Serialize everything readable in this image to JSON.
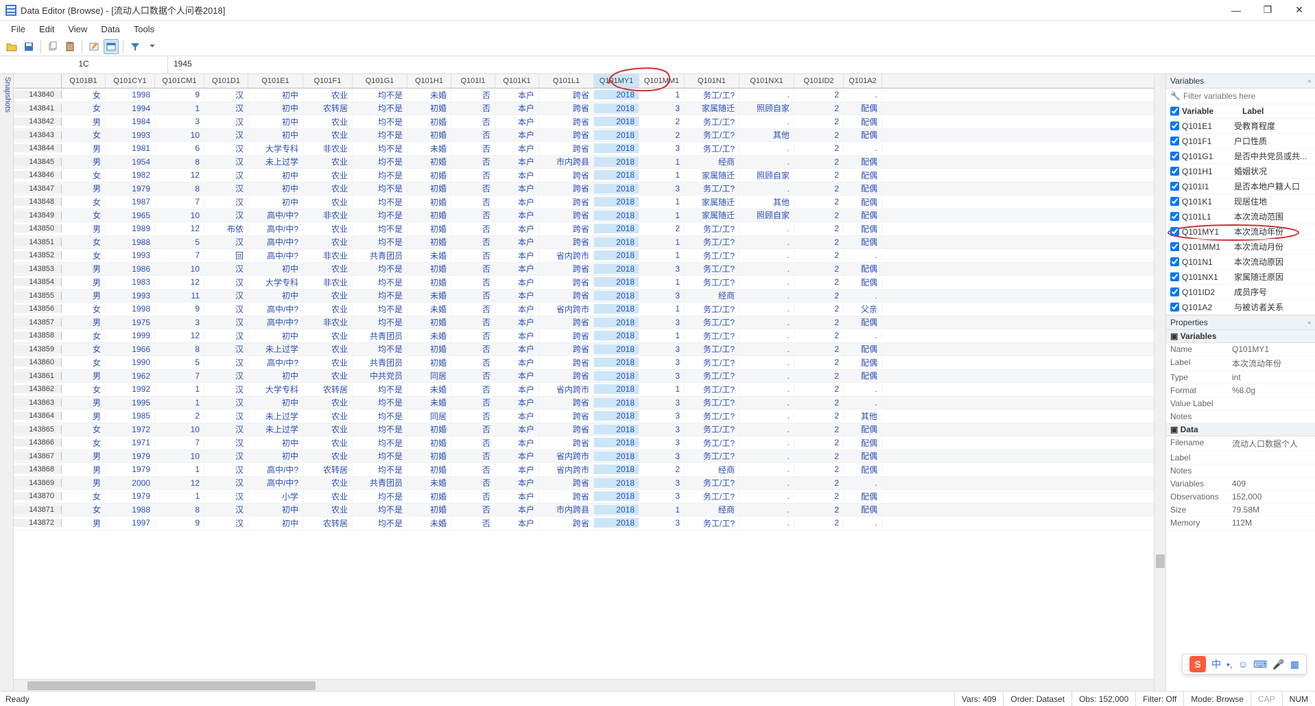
{
  "title": "Data Editor (Browse) - [流动人口数据个人问卷2018]",
  "menu": [
    "File",
    "Edit",
    "View",
    "Data",
    "Tools"
  ],
  "cellbar": {
    "ref": "1C",
    "val": "1945"
  },
  "snapshots_label": "Snapshots",
  "columns": [
    {
      "key": "Q101B1",
      "w": "w-b1"
    },
    {
      "key": "Q101CY1",
      "w": "w-cy1"
    },
    {
      "key": "Q101CM1",
      "w": "w-cm1"
    },
    {
      "key": "Q101D1",
      "w": "w-d1"
    },
    {
      "key": "Q101E1",
      "w": "w-e1"
    },
    {
      "key": "Q101F1",
      "w": "w-f1"
    },
    {
      "key": "Q101G1",
      "w": "w-g1"
    },
    {
      "key": "Q101H1",
      "w": "w-h1"
    },
    {
      "key": "Q101I1",
      "w": "w-i1"
    },
    {
      "key": "Q101K1",
      "w": "w-k1"
    },
    {
      "key": "Q101L1",
      "w": "w-l1"
    },
    {
      "key": "Q101MY1",
      "w": "w-my1",
      "hilite": true
    },
    {
      "key": "Q101MM1",
      "w": "w-mm1"
    },
    {
      "key": "Q101N1",
      "w": "w-n1"
    },
    {
      "key": "Q101NX1",
      "w": "w-nx1"
    },
    {
      "key": "Q101ID2",
      "w": "w-id2"
    },
    {
      "key": "Q101A2",
      "w": "w-a2"
    }
  ],
  "rows": [
    {
      "n": 143840,
      "c": [
        "女",
        "1998",
        "9",
        "汉",
        "初中",
        "农业",
        "均不是",
        "未婚",
        "否",
        "本户",
        "跨省",
        "2018",
        "1",
        "务工/工?",
        ".",
        "2",
        "."
      ]
    },
    {
      "n": 143841,
      "c": [
        "女",
        "1994",
        "1",
        "汉",
        "初中",
        "农转居",
        "均不是",
        "初婚",
        "否",
        "本户",
        "跨省",
        "2018",
        "3",
        "家属随迁",
        "照顾自家",
        "2",
        "配偶"
      ]
    },
    {
      "n": 143842,
      "c": [
        "男",
        "1984",
        "3",
        "汉",
        "初中",
        "农业",
        "均不是",
        "初婚",
        "否",
        "本户",
        "跨省",
        "2018",
        "2",
        "务工/工?",
        ".",
        "2",
        "配偶"
      ]
    },
    {
      "n": 143843,
      "c": [
        "女",
        "1993",
        "10",
        "汉",
        "初中",
        "农业",
        "均不是",
        "初婚",
        "否",
        "本户",
        "跨省",
        "2018",
        "2",
        "务工/工?",
        "其他",
        "2",
        "配偶"
      ]
    },
    {
      "n": 143844,
      "c": [
        "男",
        "1981",
        "6",
        "汉",
        "大学专科",
        "非农业",
        "均不是",
        "未婚",
        "否",
        "本户",
        "跨省",
        "2018",
        "3",
        "务工/工?",
        ".",
        "2",
        "."
      ]
    },
    {
      "n": 143845,
      "c": [
        "男",
        "1954",
        "8",
        "汉",
        "未上过学",
        "农业",
        "均不是",
        "初婚",
        "否",
        "本户",
        "市内跨县",
        "2018",
        "1",
        "经商",
        ".",
        "2",
        "配偶"
      ]
    },
    {
      "n": 143846,
      "c": [
        "女",
        "1982",
        "12",
        "汉",
        "初中",
        "农业",
        "均不是",
        "初婚",
        "否",
        "本户",
        "跨省",
        "2018",
        "1",
        "家属随迁",
        "照顾自家",
        "2",
        "配偶"
      ]
    },
    {
      "n": 143847,
      "c": [
        "男",
        "1979",
        "8",
        "汉",
        "初中",
        "农业",
        "均不是",
        "初婚",
        "否",
        "本户",
        "跨省",
        "2018",
        "3",
        "务工/工?",
        ".",
        "2",
        "配偶"
      ]
    },
    {
      "n": 143848,
      "c": [
        "女",
        "1987",
        "7",
        "汉",
        "初中",
        "农业",
        "均不是",
        "初婚",
        "否",
        "本户",
        "跨省",
        "2018",
        "1",
        "家属随迁",
        "其他",
        "2",
        "配偶"
      ]
    },
    {
      "n": 143849,
      "c": [
        "女",
        "1965",
        "10",
        "汉",
        "高中/中?",
        "非农业",
        "均不是",
        "初婚",
        "否",
        "本户",
        "跨省",
        "2018",
        "1",
        "家属随迁",
        "照顾自家",
        "2",
        "配偶"
      ]
    },
    {
      "n": 143850,
      "c": [
        "男",
        "1989",
        "12",
        "布依",
        "高中/中?",
        "农业",
        "均不是",
        "初婚",
        "否",
        "本户",
        "跨省",
        "2018",
        "2",
        "务工/工?",
        ".",
        "2",
        "配偶"
      ]
    },
    {
      "n": 143851,
      "c": [
        "女",
        "1988",
        "5",
        "汉",
        "高中/中?",
        "农业",
        "均不是",
        "初婚",
        "否",
        "本户",
        "跨省",
        "2018",
        "1",
        "务工/工?",
        ".",
        "2",
        "配偶"
      ]
    },
    {
      "n": 143852,
      "c": [
        "女",
        "1993",
        "7",
        "回",
        "高中/中?",
        "非农业",
        "共青团员",
        "未婚",
        "否",
        "本户",
        "省内跨市",
        "2018",
        "1",
        "务工/工?",
        ".",
        "2",
        "."
      ]
    },
    {
      "n": 143853,
      "c": [
        "男",
        "1986",
        "10",
        "汉",
        "初中",
        "农业",
        "均不是",
        "初婚",
        "否",
        "本户",
        "跨省",
        "2018",
        "3",
        "务工/工?",
        ".",
        "2",
        "配偶"
      ]
    },
    {
      "n": 143854,
      "c": [
        "男",
        "1983",
        "12",
        "汉",
        "大学专科",
        "非农业",
        "均不是",
        "初婚",
        "否",
        "本户",
        "跨省",
        "2018",
        "1",
        "务工/工?",
        ".",
        "2",
        "配偶"
      ]
    },
    {
      "n": 143855,
      "c": [
        "男",
        "1993",
        "11",
        "汉",
        "初中",
        "农业",
        "均不是",
        "未婚",
        "否",
        "本户",
        "跨省",
        "2018",
        "3",
        "经商",
        ".",
        "2",
        "."
      ]
    },
    {
      "n": 143856,
      "c": [
        "女",
        "1998",
        "9",
        "汉",
        "高中/中?",
        "农业",
        "均不是",
        "未婚",
        "否",
        "本户",
        "省内跨市",
        "2018",
        "1",
        "务工/工?",
        ".",
        "2",
        "父亲"
      ]
    },
    {
      "n": 143857,
      "c": [
        "男",
        "1975",
        "3",
        "汉",
        "高中/中?",
        "非农业",
        "均不是",
        "初婚",
        "否",
        "本户",
        "跨省",
        "2018",
        "3",
        "务工/工?",
        ".",
        "2",
        "配偶"
      ]
    },
    {
      "n": 143858,
      "c": [
        "女",
        "1999",
        "12",
        "汉",
        "初中",
        "农业",
        "共青团员",
        "未婚",
        "否",
        "本户",
        "跨省",
        "2018",
        "1",
        "务工/工?",
        ".",
        "2",
        "."
      ]
    },
    {
      "n": 143859,
      "c": [
        "女",
        "1966",
        "8",
        "汉",
        "未上过学",
        "农业",
        "均不是",
        "初婚",
        "否",
        "本户",
        "跨省",
        "2018",
        "3",
        "务工/工?",
        ".",
        "2",
        "配偶"
      ]
    },
    {
      "n": 143860,
      "c": [
        "女",
        "1990",
        "5",
        "汉",
        "高中/中?",
        "农业",
        "共青团员",
        "初婚",
        "否",
        "本户",
        "跨省",
        "2018",
        "3",
        "务工/工?",
        ".",
        "2",
        "配偶"
      ]
    },
    {
      "n": 143861,
      "c": [
        "男",
        "1962",
        "7",
        "汉",
        "初中",
        "农业",
        "中共党员",
        "同居",
        "否",
        "本户",
        "跨省",
        "2018",
        "3",
        "务工/工?",
        ".",
        "2",
        "配偶"
      ]
    },
    {
      "n": 143862,
      "c": [
        "女",
        "1992",
        "1",
        "汉",
        "大学专科",
        "农转居",
        "均不是",
        "未婚",
        "否",
        "本户",
        "省内跨市",
        "2018",
        "1",
        "务工/工?",
        ".",
        "2",
        "."
      ]
    },
    {
      "n": 143863,
      "c": [
        "男",
        "1995",
        "1",
        "汉",
        "初中",
        "农业",
        "均不是",
        "未婚",
        "否",
        "本户",
        "跨省",
        "2018",
        "3",
        "务工/工?",
        ".",
        "2",
        "."
      ]
    },
    {
      "n": 143864,
      "c": [
        "男",
        "1985",
        "2",
        "汉",
        "未上过学",
        "农业",
        "均不是",
        "同居",
        "否",
        "本户",
        "跨省",
        "2018",
        "3",
        "务工/工?",
        ".",
        "2",
        "其他"
      ]
    },
    {
      "n": 143865,
      "c": [
        "女",
        "1972",
        "10",
        "汉",
        "未上过学",
        "农业",
        "均不是",
        "初婚",
        "否",
        "本户",
        "跨省",
        "2018",
        "3",
        "务工/工?",
        ".",
        "2",
        "配偶"
      ]
    },
    {
      "n": 143866,
      "c": [
        "女",
        "1971",
        "7",
        "汉",
        "初中",
        "农业",
        "均不是",
        "初婚",
        "否",
        "本户",
        "跨省",
        "2018",
        "3",
        "务工/工?",
        ".",
        "2",
        "配偶"
      ]
    },
    {
      "n": 143867,
      "c": [
        "男",
        "1979",
        "10",
        "汉",
        "初中",
        "农业",
        "均不是",
        "初婚",
        "否",
        "本户",
        "省内跨市",
        "2018",
        "3",
        "务工/工?",
        ".",
        "2",
        "配偶"
      ]
    },
    {
      "n": 143868,
      "c": [
        "男",
        "1979",
        "1",
        "汉",
        "高中/中?",
        "农转居",
        "均不是",
        "初婚",
        "否",
        "本户",
        "省内跨市",
        "2018",
        "2",
        "经商",
        ".",
        "2",
        "配偶"
      ]
    },
    {
      "n": 143869,
      "c": [
        "男",
        "2000",
        "12",
        "汉",
        "高中/中?",
        "农业",
        "共青团员",
        "未婚",
        "否",
        "本户",
        "跨省",
        "2018",
        "3",
        "务工/工?",
        ".",
        "2",
        "."
      ]
    },
    {
      "n": 143870,
      "c": [
        "女",
        "1979",
        "1",
        "汉",
        "小学",
        "农业",
        "均不是",
        "初婚",
        "否",
        "本户",
        "跨省",
        "2018",
        "3",
        "务工/工?",
        ".",
        "2",
        "配偶"
      ]
    },
    {
      "n": 143871,
      "c": [
        "女",
        "1988",
        "8",
        "汉",
        "初中",
        "农业",
        "均不是",
        "初婚",
        "否",
        "本户",
        "市内跨县",
        "2018",
        "1",
        "经商",
        ".",
        "2",
        "配偶"
      ]
    },
    {
      "n": 143872,
      "c": [
        "男",
        "1997",
        "9",
        "汉",
        "初中",
        "农转居",
        "均不是",
        "未婚",
        "否",
        "本户",
        "跨省",
        "2018",
        "3",
        "务工/工?",
        ".",
        "2",
        "."
      ]
    }
  ],
  "varpanel": {
    "title": "Variables",
    "filter_placeholder": "Filter variables here",
    "hdr_var": "Variable",
    "hdr_lbl": "Label",
    "items": [
      {
        "v": "Q101E1",
        "l": "受教育程度"
      },
      {
        "v": "Q101F1",
        "l": "户口性质"
      },
      {
        "v": "Q101G1",
        "l": "是否中共党员或共..."
      },
      {
        "v": "Q101H1",
        "l": "婚姻状况"
      },
      {
        "v": "Q101I1",
        "l": "是否本地户籍人口"
      },
      {
        "v": "Q101K1",
        "l": "现居住地"
      },
      {
        "v": "Q101L1",
        "l": "本次流动范围"
      },
      {
        "v": "Q101MY1",
        "l": "本次流动年份",
        "hilite": true
      },
      {
        "v": "Q101MM1",
        "l": "本次流动月份"
      },
      {
        "v": "Q101N1",
        "l": "本次流动原因"
      },
      {
        "v": "Q101NX1",
        "l": "家属随迁原因"
      },
      {
        "v": "Q101ID2",
        "l": "成员序号"
      },
      {
        "v": "Q101A2",
        "l": "与被访者关系"
      }
    ]
  },
  "props": {
    "title": "Properties",
    "group_vars": "Variables",
    "vars": [
      {
        "k": "Name",
        "v": "Q101MY1"
      },
      {
        "k": "Label",
        "v": "本次流动年份"
      },
      {
        "k": "Type",
        "v": "int"
      },
      {
        "k": "Format",
        "v": "%8.0g"
      },
      {
        "k": "Value Label",
        "v": ""
      },
      {
        "k": "Notes",
        "v": ""
      }
    ],
    "group_data": "Data",
    "data": [
      {
        "k": "Filename",
        "v": "流动人口数据个人"
      },
      {
        "k": "Label",
        "v": ""
      },
      {
        "k": "Notes",
        "v": ""
      },
      {
        "k": "Variables",
        "v": "409"
      },
      {
        "k": "Observations",
        "v": "152,000"
      },
      {
        "k": "Size",
        "v": "79.58M"
      },
      {
        "k": "Memory",
        "v": "112M"
      }
    ]
  },
  "status": {
    "ready": "Ready",
    "vars": "Vars: 409",
    "order": "Order: Dataset",
    "obs": "Obs: 152,000",
    "filter": "Filter: Off",
    "mode": "Mode: Browse",
    "cap": "CAP",
    "num": "NUM"
  },
  "ime_label": "中"
}
